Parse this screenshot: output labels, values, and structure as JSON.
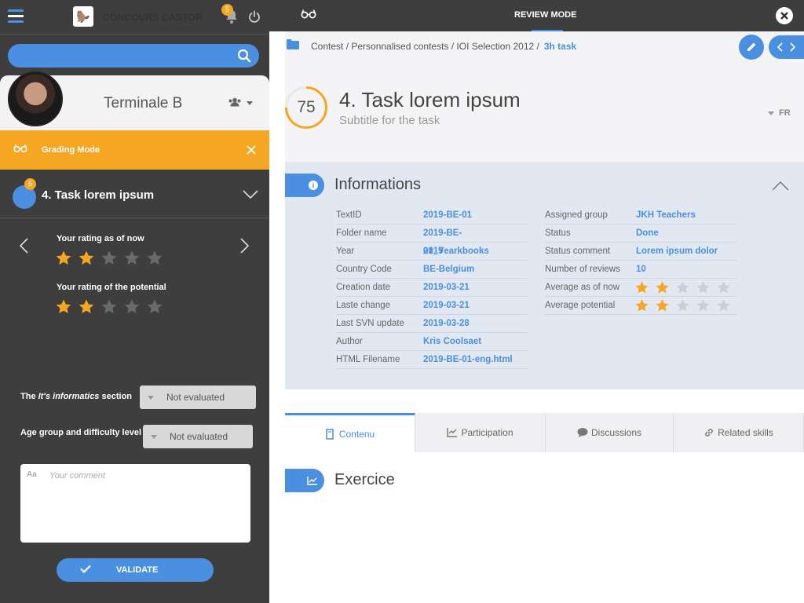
{
  "sidebar": {
    "app_title": "CONCOURS CASTOR",
    "notification_count": "5",
    "profile_name": "Terminale B",
    "grading_mode_label": "Grading Mode",
    "task_badge": "5",
    "task_title": "4. Task lorem ipsum",
    "rating_now_label": "Your rating as of now",
    "rating_now_value": 2,
    "rating_potential_label": "Your rating of the potential",
    "rating_potential_value": 2,
    "rating_max": 5,
    "section_label_pre": "The ",
    "section_label_em": "It's informatics",
    "section_label_post": " section",
    "section_value": "Not evaluated",
    "age_label": "Age group and difficulty level",
    "age_value": "Not evaluated",
    "comment_prefix": "Aa",
    "comment_placeholder": "Your comment",
    "validate_label": "VALIDATE"
  },
  "topbar": {
    "title": "REVIEW MODE"
  },
  "breadcrumb": {
    "path": "Contest / Personnalised contests / IOI Selection 2012 /",
    "current": "3h task"
  },
  "task": {
    "score": "75",
    "title": "4. Task lorem ipsum",
    "subtitle": "Subtitle for the task",
    "lang": "FR"
  },
  "informations": {
    "title": "Informations",
    "left": [
      {
        "key": "TextID",
        "value": "2019-BE-01"
      },
      {
        "key": "Folder name",
        "value": "2019-BE-01_Yearkbooks"
      },
      {
        "key": "Year",
        "value": "2019"
      },
      {
        "key": "Country Code",
        "value": "BE-Belgium"
      },
      {
        "key": "Creation date",
        "value": "2019-03-21"
      },
      {
        "key": "Laste change",
        "value": "2019-03-21"
      },
      {
        "key": "Last SVN update",
        "value": "2019-03-28"
      },
      {
        "key": "Author",
        "value": "Kris Coolsaet"
      },
      {
        "key": "HTML Filename",
        "value": "2019-BE-01-eng.html"
      }
    ],
    "right": [
      {
        "key": "Assigned group",
        "value": "JKH Teachers"
      },
      {
        "key": "Status",
        "value": "Done"
      },
      {
        "key": "Status comment",
        "value": "Lorem ipsum dolor"
      },
      {
        "key": "Number of reviews",
        "value": "10"
      },
      {
        "key": "Average as of now",
        "stars": 2
      },
      {
        "key": "Average potential",
        "stars": 2
      }
    ]
  },
  "tabs": [
    {
      "label": "Contenu",
      "icon": "book-icon",
      "active": true
    },
    {
      "label": "Participation",
      "icon": "chart-icon"
    },
    {
      "label": "Discussions",
      "icon": "chat-icon"
    },
    {
      "label": "Related skills",
      "icon": "link-icon"
    }
  ],
  "exercice": {
    "title": "Exercice"
  },
  "colors": {
    "accent": "#4a8fe0",
    "orange": "#f5a623",
    "sidebar": "#3e3e3e"
  }
}
